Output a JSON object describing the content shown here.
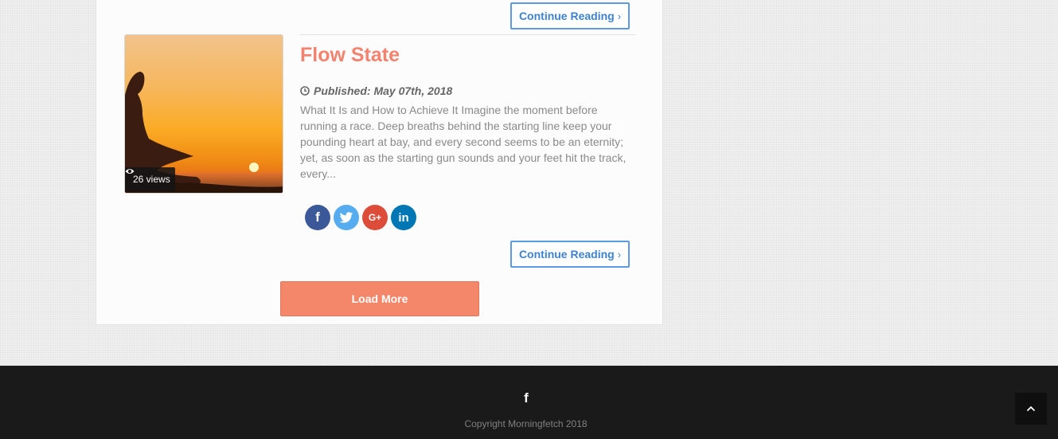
{
  "post": {
    "top_continue_label": "Continue Reading",
    "title": "Flow State",
    "published": "Published: May 07th, 2018",
    "excerpt": "What It Is and How to Achieve It Imagine the moment before running a race. Deep breaths behind the starting line keep your pounding heart at bay, and every second seems to be an eternity; yet, as soon as the starting gun sounds and your feet hit the track, every...",
    "views": "26 views",
    "continue_label": "Continue Reading",
    "chevron": "›",
    "social": [
      {
        "name": "facebook",
        "glyph": "f",
        "color": "#3b5998"
      },
      {
        "name": "twitter",
        "glyph": "t",
        "color": "#55acee"
      },
      {
        "name": "google-plus",
        "glyph": "G+",
        "color": "#dd4b39"
      },
      {
        "name": "linkedin",
        "glyph": "in",
        "color": "#0077b5"
      }
    ]
  },
  "load_more_label": "Load More",
  "footer": {
    "facebook_glyph": "f",
    "copyright": "Copyright Morningfetch 2018"
  },
  "colors": {
    "accent_title": "#f3826f",
    "link_blue": "#3d82cf",
    "load_more_bg": "#f4876a",
    "footer_bg": "#1a1a1a"
  }
}
